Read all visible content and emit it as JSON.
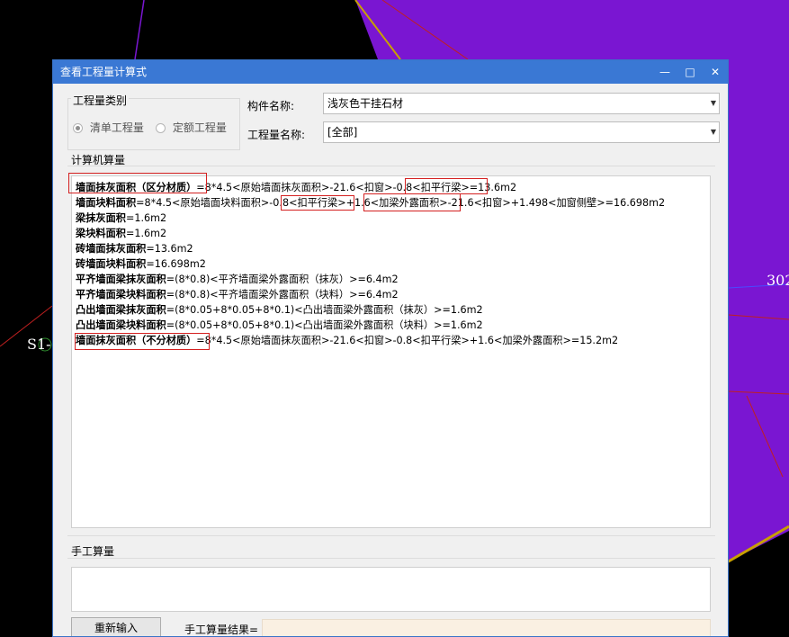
{
  "background": {
    "colors": {
      "purple": "#7a16d2",
      "purple_edge": "#6a0fbf",
      "black": "#000000"
    },
    "labels": {
      "right_number": "302",
      "left_tag": "S1-"
    }
  },
  "dialog": {
    "title": "查看工程量计算式",
    "window_buttons": {
      "minimize": "—",
      "maximize": "□",
      "close": "✕"
    },
    "quantity_type_group": {
      "legend": "工程量类别",
      "options": [
        {
          "label": "清单工程量",
          "checked": true
        },
        {
          "label": "定额工程量",
          "checked": false
        }
      ]
    },
    "component_name": {
      "label": "构件名称:",
      "value": "浅灰色干挂石材"
    },
    "quantity_name": {
      "label": "工程量名称:",
      "value": "[全部]"
    },
    "computer_calc": {
      "heading": "计算机算量",
      "lines": [
        {
          "name": "墙面抹灰面积（区分材质）",
          "formula": "=8*4.5<原始墙面抹灰面积>-21.6<扣窗>-0.8<扣平行梁>=13.6m2"
        },
        {
          "name": "墙面块料面积",
          "formula": "=8*4.5<原始墙面块料面积>-0.8<扣平行梁>+1.6<加梁外露面积>-21.6<扣窗>+1.498<加窗侧壁>=16.698m2"
        },
        {
          "name": "梁抹灰面积",
          "formula": "=1.6m2"
        },
        {
          "name": "梁块料面积",
          "formula": "=1.6m2"
        },
        {
          "name": "砖墙面抹灰面积",
          "formula": "=13.6m2"
        },
        {
          "name": "砖墙面块料面积",
          "formula": "=16.698m2"
        },
        {
          "name": "平齐墙面梁抹灰面积",
          "formula": "=(8*0.8)<平齐墙面梁外露面积（抹灰）>=6.4m2"
        },
        {
          "name": "平齐墙面梁块料面积",
          "formula": "=(8*0.8)<平齐墙面梁外露面积（块料）>=6.4m2"
        },
        {
          "name": "凸出墙面梁抹灰面积",
          "formula": "=(8*0.05+8*0.05+8*0.1)<凸出墙面梁外露面积（抹灰）>=1.6m2"
        },
        {
          "name": "凸出墙面梁块料面积",
          "formula": "=(8*0.05+8*0.05+8*0.1)<凸出墙面梁外露面积（块料）>=1.6m2"
        },
        {
          "name": "墙面抹灰面积（不分材质）",
          "formula": "=8*4.5<原始墙面抹灰面积>-21.6<扣窗>-0.8<扣平行梁>+1.6<加梁外露面积>=15.2m2"
        }
      ],
      "highlight_color": "#d42020"
    },
    "manual_calc": {
      "heading": "手工算量",
      "reenter_button": "重新输入",
      "result_label": "手工算量结果=",
      "result_value": ""
    }
  }
}
